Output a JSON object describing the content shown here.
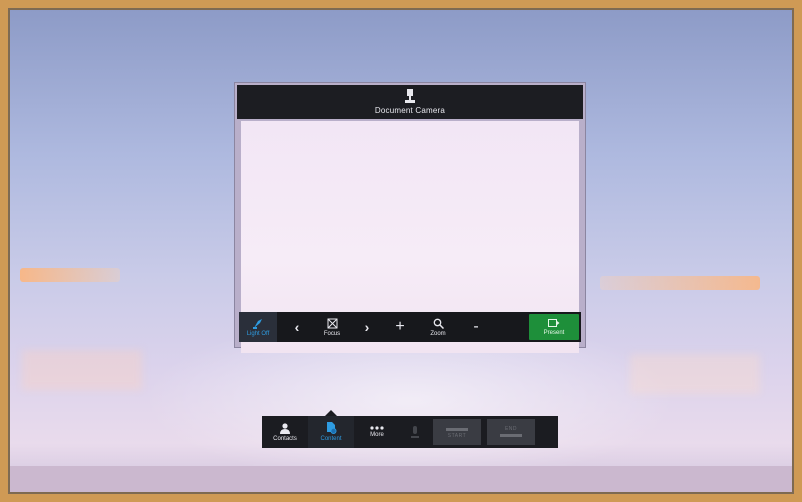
{
  "document_camera": {
    "title": "Document Camera",
    "icon": "document-camera-icon",
    "toolbar": {
      "light": {
        "label": "Light Off",
        "icon": "lamp-icon",
        "active_color": "#2e9be0"
      },
      "focus_prev": "‹",
      "focus": {
        "label": "Focus",
        "icon": "focus-icon"
      },
      "focus_next": "›",
      "zoom_in": "+",
      "zoom": {
        "label": "Zoom",
        "icon": "magnifier-icon"
      },
      "zoom_out": "-",
      "present": {
        "label": "Present",
        "icon": "present-icon",
        "color": "#1e8f3a"
      }
    }
  },
  "dock": {
    "contacts": {
      "label": "Contacts",
      "icon": "person-icon"
    },
    "content": {
      "label": "Content",
      "icon": "content-share-icon",
      "active": true
    },
    "more": {
      "label": "More",
      "icon": "ellipsis-icon"
    },
    "mic": {
      "icon": "microphone-icon",
      "disabled": true
    },
    "start": {
      "label": "START",
      "disabled": true
    },
    "end": {
      "label": "END",
      "disabled": true
    }
  }
}
